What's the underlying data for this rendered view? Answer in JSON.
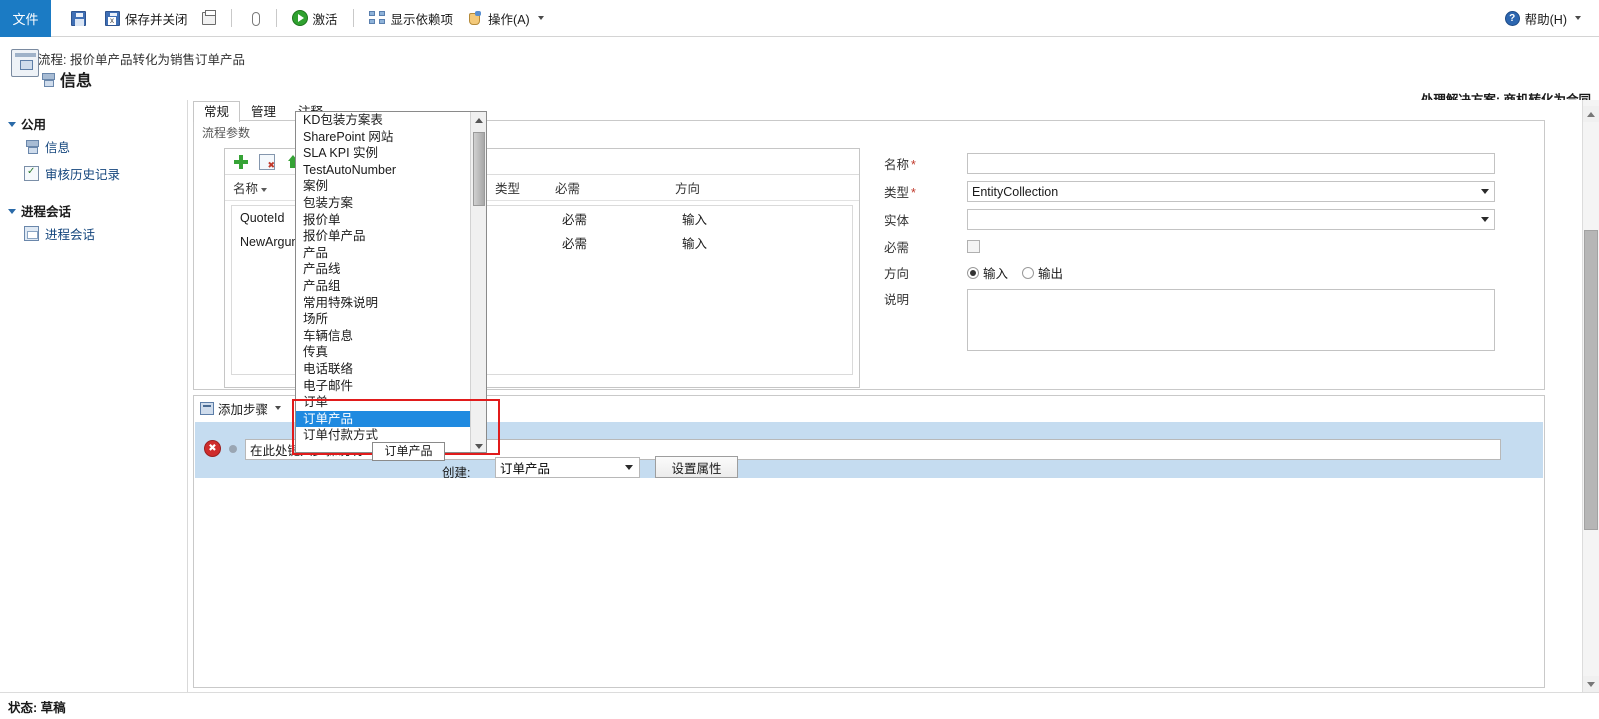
{
  "commandbar": {
    "file_label": "文件",
    "buttons": [
      {
        "label": "",
        "icon": "save-icon"
      },
      {
        "label": "保存并关闭",
        "icon": "save-and-close-icon"
      },
      {
        "label": "",
        "icon": "print-icon"
      },
      {
        "label": "",
        "icon": "attachment-icon"
      },
      {
        "label": "激活",
        "icon": "activate-icon"
      },
      {
        "label": "显示依赖项",
        "icon": "dependencies-icon"
      },
      {
        "label": "操作(A)",
        "icon": "actions-icon"
      }
    ],
    "help_label": "帮助(H)"
  },
  "header": {
    "process_label": "流程: 报价单产品转化为销售订单产品",
    "title": "信息",
    "solution_label": "处理解决方案: 商机转化为合同"
  },
  "sidebar": {
    "groups": [
      {
        "label": "公用",
        "items": [
          {
            "label": "信息",
            "icon": "info-icon"
          },
          {
            "label": "审核历史记录",
            "icon": "audit-history-icon"
          }
        ]
      },
      {
        "label": "进程会话",
        "items": [
          {
            "label": "进程会话",
            "icon": "process-session-icon"
          }
        ]
      }
    ]
  },
  "tabs": [
    {
      "label": "常规",
      "active": true
    },
    {
      "label": "管理",
      "active": false
    },
    {
      "label": "注释",
      "active": false
    }
  ],
  "arguments_panel": {
    "title": "流程参数",
    "toolbar": [
      {
        "icon": "add-icon",
        "label": "新建"
      },
      {
        "icon": "delete-icon",
        "label": "删除"
      },
      {
        "icon": "move-up-icon",
        "label": "上移"
      }
    ],
    "columns": [
      "名称",
      "类型",
      "必需",
      "方向"
    ],
    "rows": [
      {
        "name": "QuoteId",
        "type": "",
        "required": "必需",
        "direction": "输入"
      },
      {
        "name": "NewArgument",
        "type": "",
        "required": "必需",
        "direction": "输入"
      }
    ]
  },
  "form": {
    "name_label": "名称",
    "name_value": "",
    "type_label": "类型",
    "type_value": "EntityCollection",
    "entity_label": "实体",
    "entity_value": "",
    "required_label": "必需",
    "required_checked": false,
    "direction_label": "方向",
    "direction_options": [
      "输入",
      "输出"
    ],
    "direction_selected": "输入",
    "description_label": "说明",
    "description_value": ""
  },
  "steps": {
    "add_step_label": "添加步骤",
    "step_input_value": "在此处键入步骤说明",
    "create_label": "创建:",
    "create_value": "订单产品",
    "set_properties_label": "设置属性"
  },
  "dropdown": {
    "selected": "订单产品",
    "tooltip": "订单产品",
    "items": [
      "KD包装方案表",
      "SharePoint 网站",
      "SLA KPI 实例",
      "TestAutoNumber",
      "案例",
      "包装方案",
      "报价单",
      "报价单产品",
      "产品",
      "产品线",
      "产品组",
      "常用特殊说明",
      "场所",
      "车辆信息",
      "传真",
      "电话联络",
      "电子邮件",
      "订单",
      "订单产品",
      "订单付款方式"
    ]
  },
  "statusbar": {
    "text": "状态: 草稿"
  },
  "colors": {
    "accent": "#1b7bc4",
    "selection": "#1f8ae0",
    "step_row": "#c5dcf0",
    "annotation": "#e11b1b",
    "required_star": "#c0392b"
  }
}
